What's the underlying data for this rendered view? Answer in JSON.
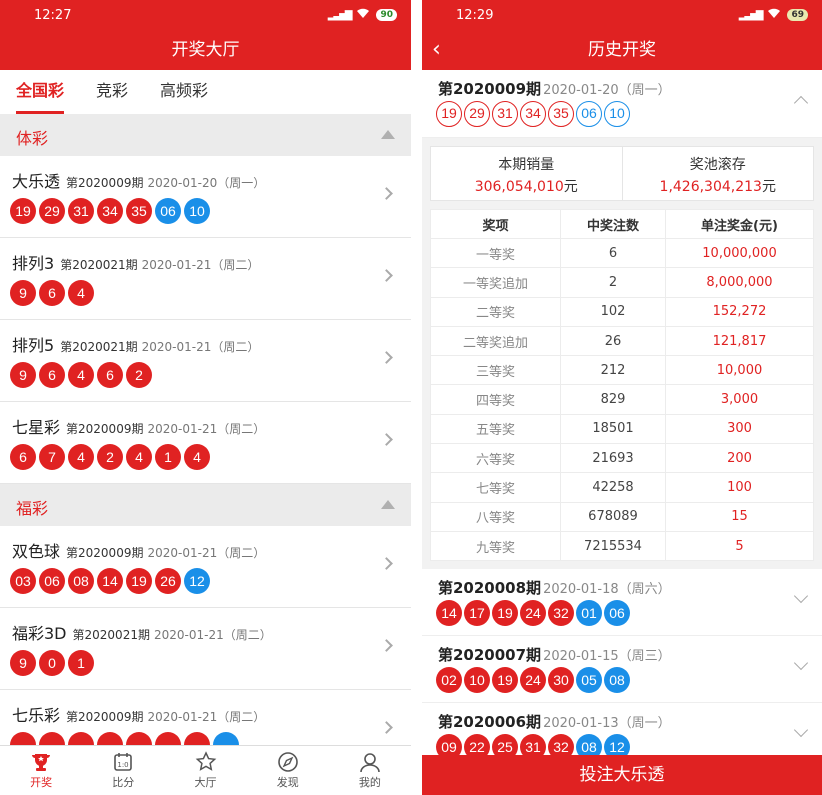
{
  "left": {
    "status": {
      "time": "12:27",
      "battery": "90"
    },
    "title": "开奖大厅",
    "tabs": [
      {
        "label": "全国彩",
        "active": true
      },
      {
        "label": "竞彩",
        "active": false
      },
      {
        "label": "高频彩",
        "active": false
      }
    ],
    "sections": [
      {
        "label": "体彩",
        "items": [
          {
            "name": "大乐透",
            "issue": "第2020009期",
            "date": "2020-01-20（周一）",
            "red": [
              "19",
              "29",
              "31",
              "34",
              "35"
            ],
            "blue": [
              "06",
              "10"
            ]
          },
          {
            "name": "排列3",
            "issue": "第2020021期",
            "date": "2020-01-21（周二）",
            "red": [
              "9",
              "6",
              "4"
            ],
            "blue": []
          },
          {
            "name": "排列5",
            "issue": "第2020021期",
            "date": "2020-01-21（周二）",
            "red": [
              "9",
              "6",
              "4",
              "6",
              "2"
            ],
            "blue": []
          },
          {
            "name": "七星彩",
            "issue": "第2020009期",
            "date": "2020-01-21（周二）",
            "red": [
              "6",
              "7",
              "4",
              "2",
              "4",
              "1",
              "4"
            ],
            "blue": []
          }
        ]
      },
      {
        "label": "福彩",
        "items": [
          {
            "name": "双色球",
            "issue": "第2020009期",
            "date": "2020-01-21（周二）",
            "red": [
              "03",
              "06",
              "08",
              "14",
              "19",
              "26"
            ],
            "blue": [
              "12"
            ]
          },
          {
            "name": "福彩3D",
            "issue": "第2020021期",
            "date": "2020-01-21（周二）",
            "red": [
              "9",
              "0",
              "1"
            ],
            "blue": []
          },
          {
            "name": "七乐彩",
            "issue": "第2020009期",
            "date": "2020-01-21（周二）",
            "red": [
              "",
              "",
              "",
              "",
              "",
              "",
              ""
            ],
            "blue": [
              ""
            ]
          }
        ]
      }
    ],
    "nav": [
      {
        "label": "开奖",
        "icon": "trophy-icon",
        "active": true
      },
      {
        "label": "比分",
        "icon": "scoreboard-icon",
        "active": false
      },
      {
        "label": "大厅",
        "icon": "star-hall-icon",
        "active": false
      },
      {
        "label": "发现",
        "icon": "compass-icon",
        "active": false
      },
      {
        "label": "我的",
        "icon": "user-icon",
        "active": false
      }
    ]
  },
  "right": {
    "status": {
      "time": "12:29",
      "battery": "69"
    },
    "title": "历史开奖",
    "current": {
      "issue": "第2020009期",
      "date": "2020-01-20（周一）",
      "red": [
        "19",
        "29",
        "31",
        "34",
        "35"
      ],
      "blue": [
        "06",
        "10"
      ],
      "sales_label": "本期销量",
      "sales_value": "306,054,010",
      "pool_label": "奖池滚存",
      "pool_value": "1,426,304,213",
      "unit": "元",
      "table_headers": [
        "奖项",
        "中奖注数",
        "单注奖金(元)"
      ],
      "prizes": [
        {
          "level": "一等奖",
          "count": "6",
          "amount": "10,000,000"
        },
        {
          "level": "一等奖追加",
          "count": "2",
          "amount": "8,000,000"
        },
        {
          "level": "二等奖",
          "count": "102",
          "amount": "152,272"
        },
        {
          "level": "二等奖追加",
          "count": "26",
          "amount": "121,817"
        },
        {
          "level": "三等奖",
          "count": "212",
          "amount": "10,000"
        },
        {
          "level": "四等奖",
          "count": "829",
          "amount": "3,000"
        },
        {
          "level": "五等奖",
          "count": "18501",
          "amount": "300"
        },
        {
          "level": "六等奖",
          "count": "21693",
          "amount": "200"
        },
        {
          "level": "七等奖",
          "count": "42258",
          "amount": "100"
        },
        {
          "level": "八等奖",
          "count": "678089",
          "amount": "15"
        },
        {
          "level": "九等奖",
          "count": "7215534",
          "amount": "5"
        }
      ]
    },
    "history": [
      {
        "issue": "第2020008期",
        "date": "2020-01-18（周六）",
        "red": [
          "14",
          "17",
          "19",
          "24",
          "32"
        ],
        "blue": [
          "01",
          "06"
        ]
      },
      {
        "issue": "第2020007期",
        "date": "2020-01-15（周三）",
        "red": [
          "02",
          "10",
          "19",
          "24",
          "30"
        ],
        "blue": [
          "05",
          "08"
        ]
      },
      {
        "issue": "第2020006期",
        "date": "2020-01-13（周一）",
        "red": [
          "09",
          "22",
          "25",
          "31",
          "32"
        ],
        "blue": [
          "08",
          "12"
        ]
      }
    ],
    "bet_button": "投注大乐透"
  },
  "colors": {
    "accent": "#e02222",
    "blue_ball": "#1a8fe8"
  }
}
